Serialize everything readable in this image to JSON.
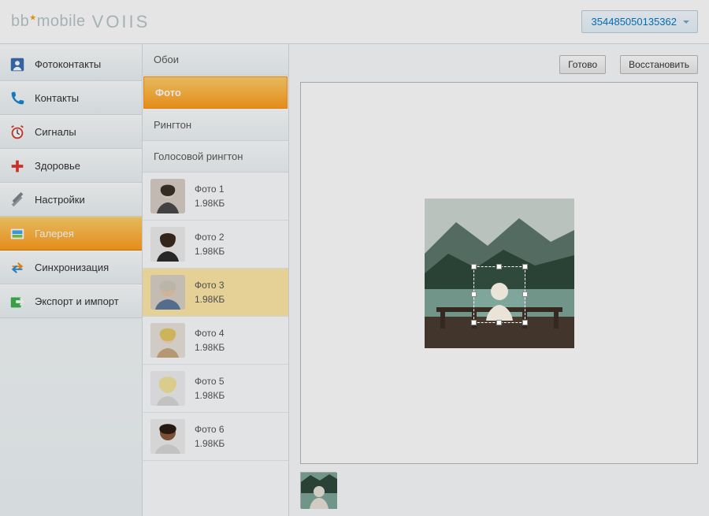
{
  "header": {
    "brand_primary": "bb",
    "brand_secondary": "mobile",
    "brand_logo": "VOIIS",
    "device_id": "354485050135362"
  },
  "sidebar": {
    "items": [
      {
        "label": "Фотоконтакты",
        "icon": "photo-contact-icon"
      },
      {
        "label": "Контакты",
        "icon": "phone-icon"
      },
      {
        "label": "Сигналы",
        "icon": "alarm-icon"
      },
      {
        "label": "Здоровье",
        "icon": "health-icon"
      },
      {
        "label": "Настройки",
        "icon": "settings-icon"
      },
      {
        "label": "Галерея",
        "icon": "gallery-icon",
        "active": true
      },
      {
        "label": "Синхронизация",
        "icon": "sync-icon"
      },
      {
        "label": "Экспорт и импорт",
        "icon": "export-icon"
      }
    ]
  },
  "tabs": [
    {
      "label": "Обои"
    },
    {
      "label": "Фото",
      "active": true
    },
    {
      "label": "Рингтон"
    },
    {
      "label": "Голосовой рингтон"
    }
  ],
  "photos": [
    {
      "name": "Фото 1",
      "size": "1.98КБ"
    },
    {
      "name": "Фото 2",
      "size": "1.98КБ"
    },
    {
      "name": "Фото 3",
      "size": "1.98КБ",
      "selected": true
    },
    {
      "name": "Фото 4",
      "size": "1.98КБ"
    },
    {
      "name": "Фото 5",
      "size": "1.98КБ"
    },
    {
      "name": "Фото 6",
      "size": "1.98КБ"
    }
  ],
  "editor": {
    "done_label": "Готово",
    "restore_label": "Восстановить"
  }
}
